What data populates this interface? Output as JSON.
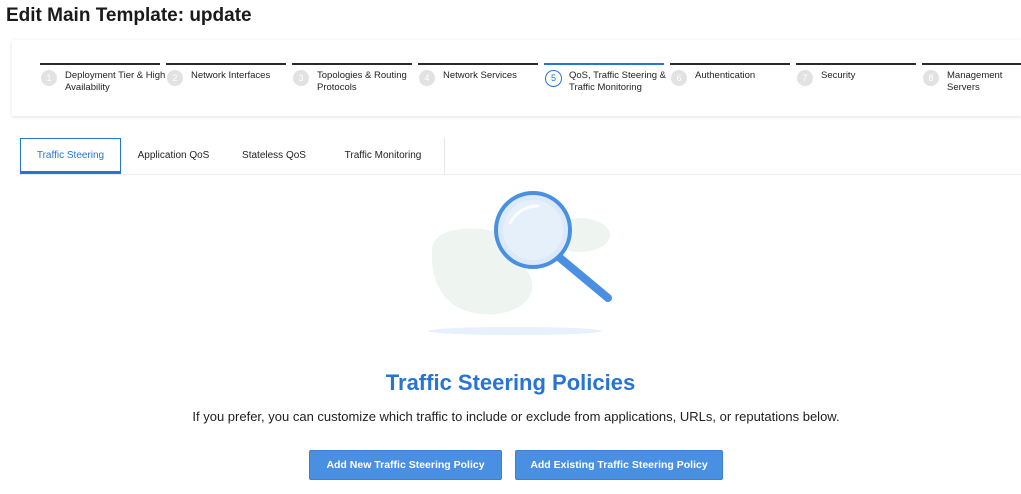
{
  "page": {
    "title": "Edit Main Template: update"
  },
  "stepper": {
    "active_index": 4,
    "steps": [
      {
        "num": "1",
        "label": "Deployment Tier & High Availability"
      },
      {
        "num": "2",
        "label": "Network Interfaces"
      },
      {
        "num": "3",
        "label": "Topologies & Routing Protocols"
      },
      {
        "num": "4",
        "label": "Network Services"
      },
      {
        "num": "5",
        "label": "QoS, Traffic Steering & Traffic Monitoring"
      },
      {
        "num": "6",
        "label": "Authentication"
      },
      {
        "num": "7",
        "label": "Security"
      },
      {
        "num": "8",
        "label": "Management Servers"
      }
    ]
  },
  "tabs": {
    "active": "Traffic Steering",
    "items": [
      "Traffic Steering",
      "Application QoS",
      "Stateless QoS",
      "Traffic Monitoring"
    ]
  },
  "empty_state": {
    "icon": "magnifying-glass-icon",
    "title": "Traffic Steering Policies",
    "description": "If you prefer, you can customize which traffic to include or exclude from applications, URLs, or reputations below."
  },
  "actions": {
    "add_new": "Add New Traffic Steering Policy",
    "add_existing": "Add Existing Traffic Steering Policy"
  },
  "colors": {
    "accent": "#2874d4",
    "button": "#4a90e2"
  }
}
